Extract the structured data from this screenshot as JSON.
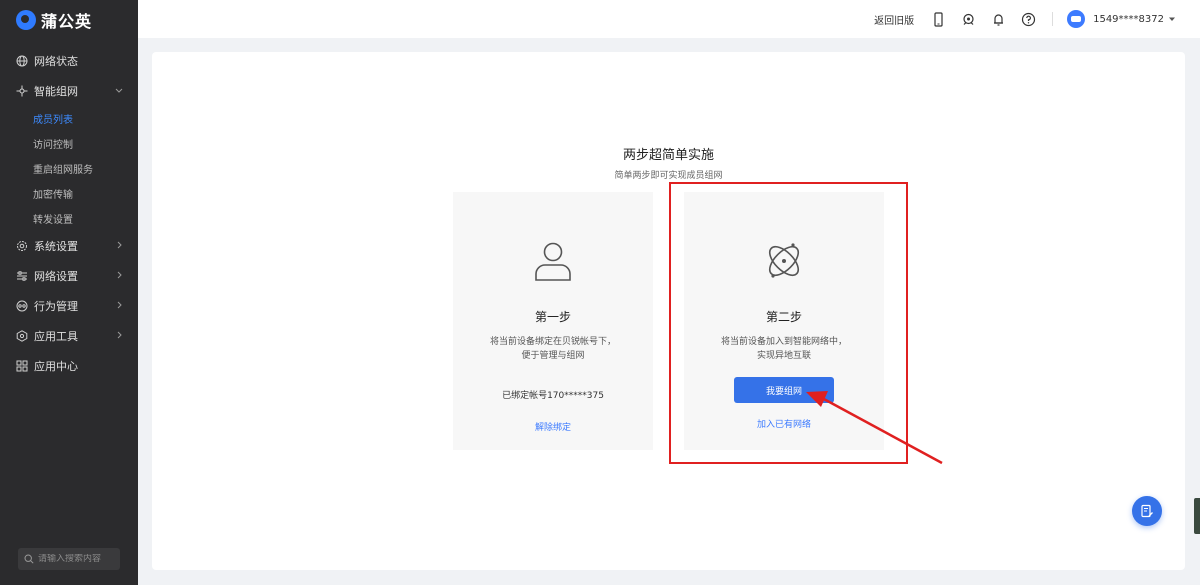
{
  "app": {
    "logo_text": "蒲公英",
    "brand_color": "#2f7bff"
  },
  "sidebar": {
    "items": [
      {
        "label": "网络状态",
        "icon": "globe-icon"
      },
      {
        "label": "智能组网",
        "icon": "network-icon",
        "expanded": true
      },
      {
        "label": "系统设置",
        "icon": "gear-icon"
      },
      {
        "label": "网络设置",
        "icon": "sliders-icon"
      },
      {
        "label": "行为管理",
        "icon": "behavior-icon"
      },
      {
        "label": "应用工具",
        "icon": "tools-icon"
      },
      {
        "label": "应用中心",
        "icon": "apps-icon"
      }
    ],
    "subitems": [
      {
        "label": "成员列表",
        "active": true
      },
      {
        "label": "访问控制"
      },
      {
        "label": "重启组网服务"
      },
      {
        "label": "加密传输"
      },
      {
        "label": "转发设置"
      }
    ],
    "search_placeholder": "请输入搜索内容"
  },
  "topbar": {
    "back_link": "返回旧版",
    "icons": [
      "phone-icon",
      "robot-icon",
      "bell-icon",
      "help-icon"
    ],
    "username": "1549****8372"
  },
  "main": {
    "title": "两步超简单实施",
    "subtitle": "简单两步即可实现成员组网",
    "step1": {
      "icon": "user-icon",
      "title": "第一步",
      "desc_line1": "将当前设备绑定在贝锐帐号下，",
      "desc_line2": "便于管理与组网",
      "bound_text": "已绑定帐号170*****375",
      "unbind_link": "解除绑定"
    },
    "step2": {
      "icon": "atom-icon",
      "title": "第二步",
      "desc_line1": "将当前设备加入到智能网络中，",
      "desc_line2": "实现异地互联",
      "primary_button": "我要组网",
      "join_link": "加入已有网络"
    }
  },
  "colors": {
    "accent": "#3572e8",
    "annotation": "#e02020",
    "sidebar_bg": "#2b2b2d"
  }
}
